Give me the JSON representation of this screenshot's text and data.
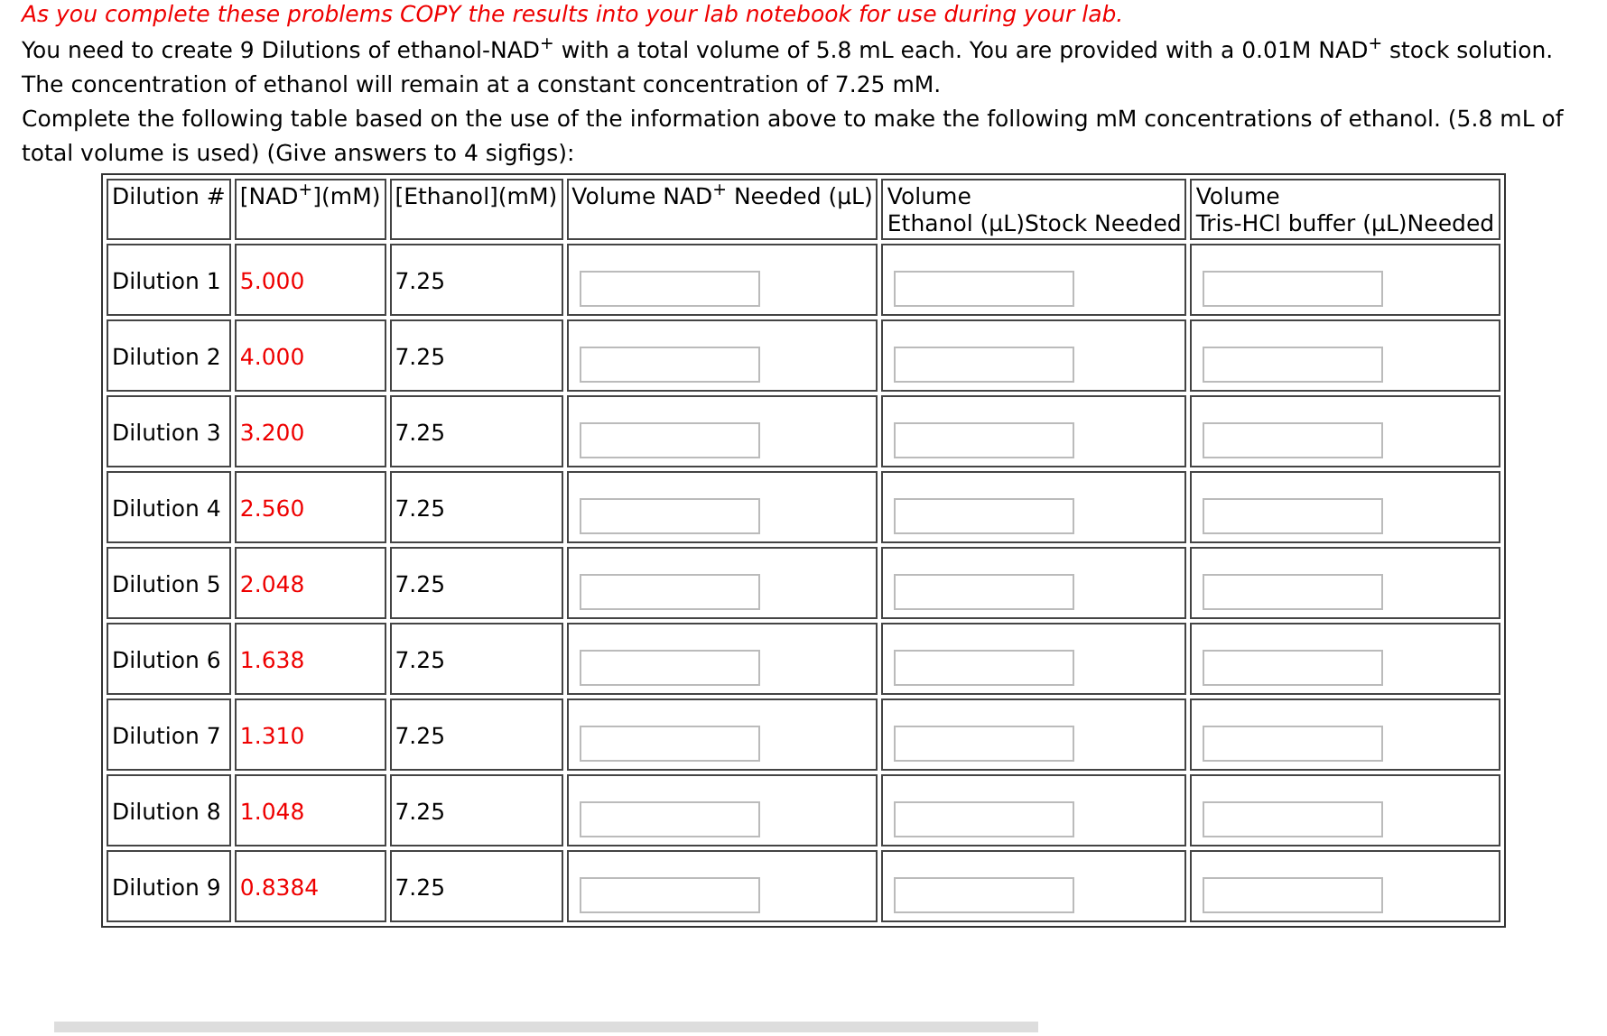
{
  "notice": "As you complete these problems COPY the results into your lab notebook for use during your lab.",
  "paragraphs": [
    "You need to create 9 Dilutions of ethanol-NAD$^{+}$ with a total volume of 5.8 mL each. You are provided with a 0.01M NAD$^{+}$ stock solution. The concentration of ethanol will remain at a constant concentration of 7.25 mM.",
    "Complete the following table based on the use of the information above to make the following mM concentrations of ethanol. (5.8 mL of total volume is used) (Give answers to 4 sigfigs):"
  ],
  "table": {
    "columns": [
      "Dilution #",
      "[NAD$^{+}$](mM)",
      "[Ethanol](mM)",
      "Volume NAD$^{+}$ Needed (μL)",
      "Volume\nEthanol (μL)Stock Needed",
      "Volume\nTris-HCl buffer (μL)Needed"
    ],
    "rows": [
      {
        "dilution": "Dilution 1",
        "nad": "5.000",
        "ethanol": "7.25"
      },
      {
        "dilution": "Dilution 2",
        "nad": "4.000",
        "ethanol": "7.25"
      },
      {
        "dilution": "Dilution 3",
        "nad": "3.200",
        "ethanol": "7.25"
      },
      {
        "dilution": "Dilution 4",
        "nad": "2.560",
        "ethanol": "7.25"
      },
      {
        "dilution": "Dilution 5",
        "nad": "2.048",
        "ethanol": "7.25"
      },
      {
        "dilution": "Dilution 6",
        "nad": "1.638",
        "ethanol": "7.25"
      },
      {
        "dilution": "Dilution 7",
        "nad": "1.310",
        "ethanol": "7.25"
      },
      {
        "dilution": "Dilution 8",
        "nad": "1.048",
        "ethanol": "7.25"
      },
      {
        "dilution": "Dilution 9",
        "nad": "0.8384",
        "ethanol": "7.25"
      }
    ]
  }
}
